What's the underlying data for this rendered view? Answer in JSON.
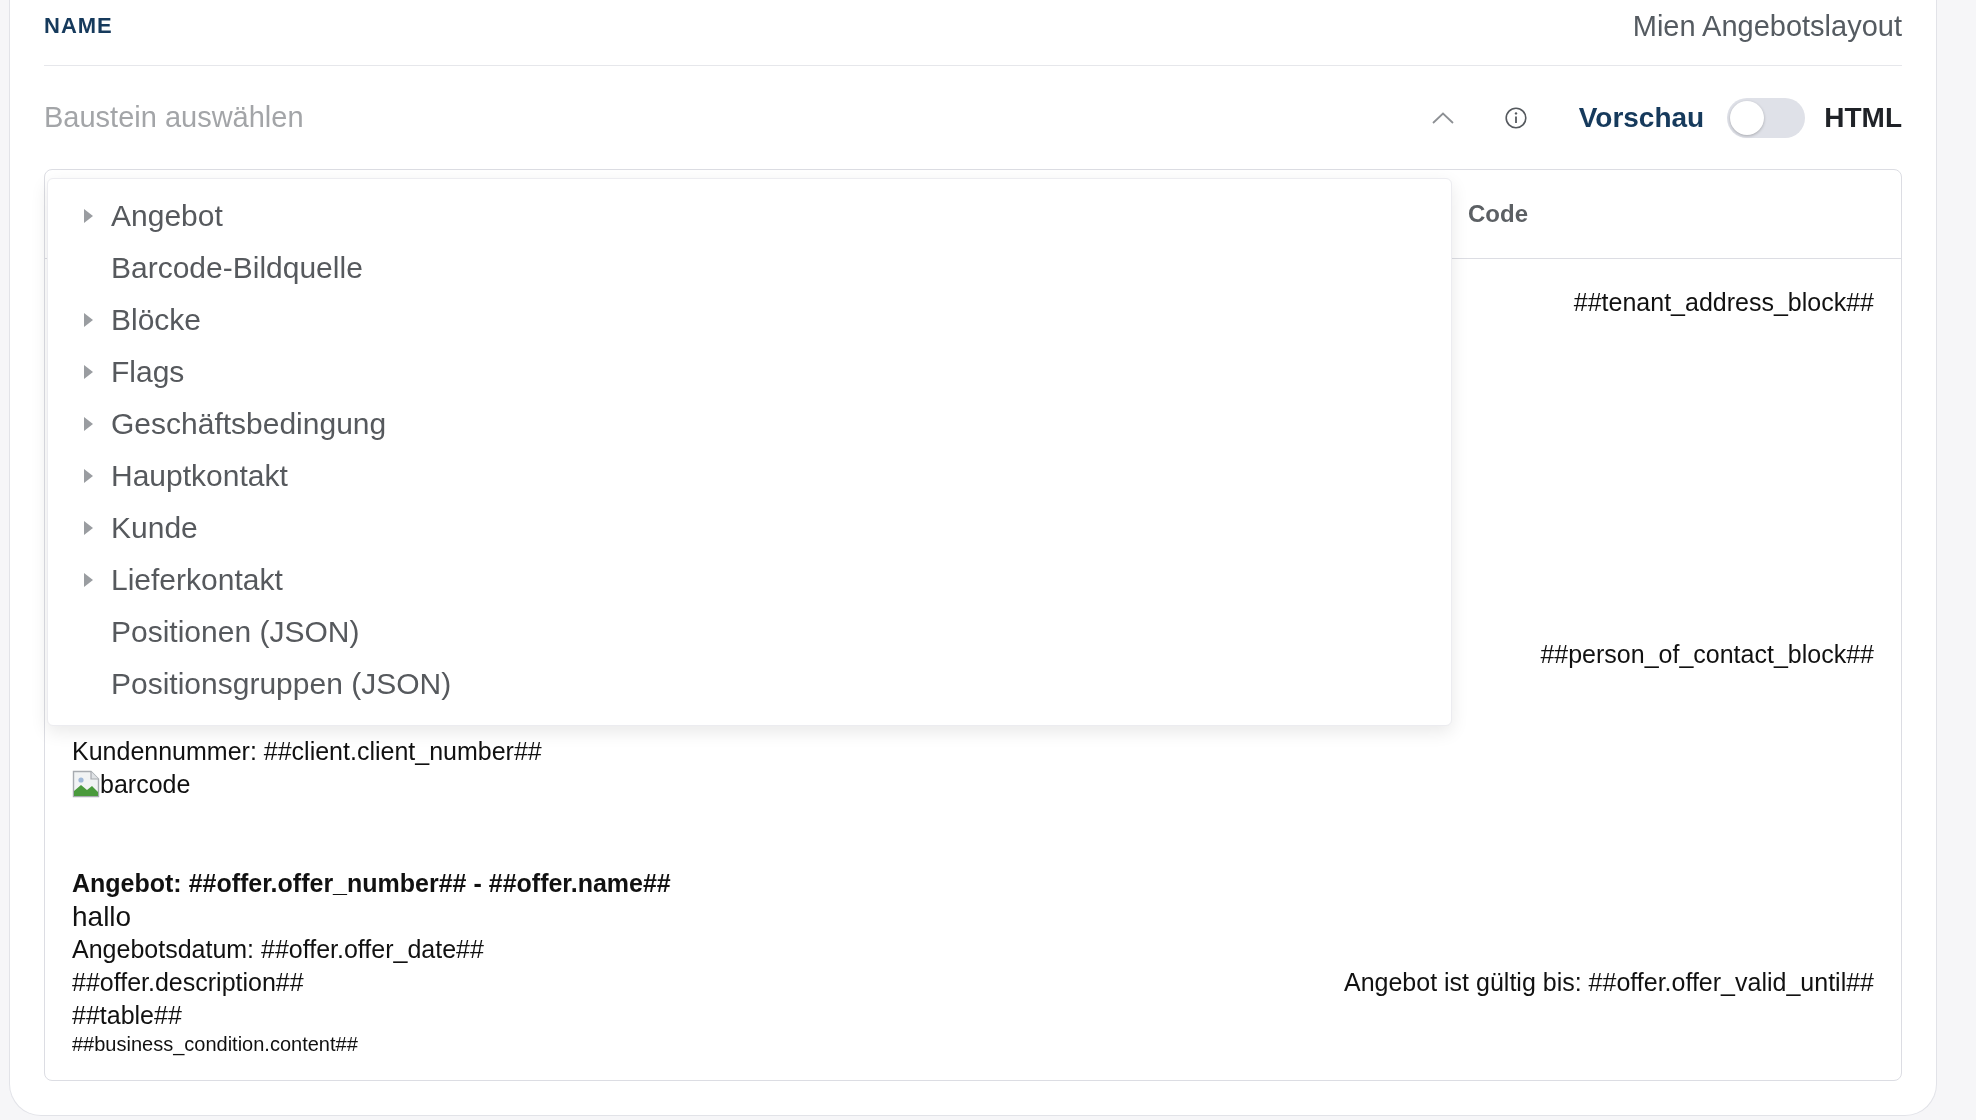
{
  "name_field": {
    "label": "NAME",
    "value": "Mien Angebotslayout"
  },
  "block_select": {
    "placeholder": "Baustein auswählen",
    "expanded": true,
    "options": [
      {
        "kind": "group",
        "label": "Angebot",
        "expanded": false
      },
      {
        "kind": "leaf",
        "label": "Barcode-Bildquelle"
      },
      {
        "kind": "group",
        "label": "Blöcke",
        "expanded": false
      },
      {
        "kind": "group",
        "label": "Flags",
        "expanded": false
      },
      {
        "kind": "group",
        "label": "Geschäftsbedingung",
        "expanded": false
      },
      {
        "kind": "group",
        "label": "Hauptkontakt",
        "expanded": false
      },
      {
        "kind": "group",
        "label": "Kunde",
        "expanded": false
      },
      {
        "kind": "group",
        "label": "Lieferkontakt",
        "expanded": false
      },
      {
        "kind": "leaf",
        "label": "Positionen (JSON)"
      },
      {
        "kind": "leaf",
        "label": "Positionsgruppen (JSON)"
      }
    ]
  },
  "view_toggle": {
    "left_label": "Vorschau",
    "right_label": "HTML",
    "on": false
  },
  "editor": {
    "header_label": "Code",
    "preview_rows": [
      {
        "kind": "right",
        "text": "##tenant_address_block##"
      },
      {
        "kind": "right",
        "text": "##person_of_contact_block##"
      },
      {
        "kind": "text",
        "text": "Kundennummer: ##client.client_number##"
      },
      {
        "kind": "image",
        "alt": "barcode"
      },
      {
        "kind": "heading",
        "text": "Angebot: ##offer.offer_number## - ##offer.name##"
      },
      {
        "kind": "large",
        "text": "hallo"
      },
      {
        "kind": "text",
        "text": "Angebotsdatum: ##offer.offer_date##"
      },
      {
        "kind": "split",
        "left": "##offer.description##",
        "right": "Angebot ist gültig bis: ##offer.offer_valid_until##"
      },
      {
        "kind": "text",
        "text": "##table##"
      },
      {
        "kind": "small",
        "text": "##business_condition.content##"
      }
    ]
  }
}
